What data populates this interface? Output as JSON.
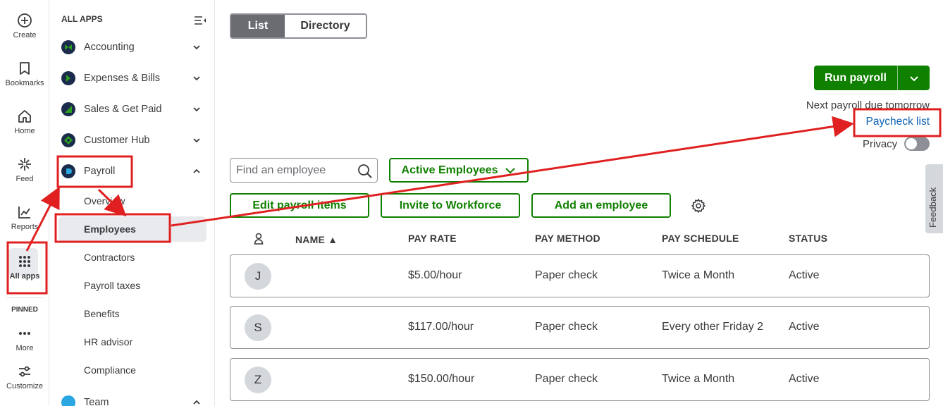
{
  "rail": {
    "create": "Create",
    "bookmarks": "Bookmarks",
    "home": "Home",
    "feed": "Feed",
    "reports": "Reports",
    "all_apps": "All apps",
    "pinned": "PINNED",
    "more": "More",
    "customize": "Customize"
  },
  "nav": {
    "header": "ALL APPS",
    "items": [
      {
        "label": "Accounting",
        "icon": "accounting-icon"
      },
      {
        "label": "Expenses & Bills",
        "icon": "expenses-icon"
      },
      {
        "label": "Sales & Get Paid",
        "icon": "sales-icon"
      },
      {
        "label": "Customer Hub",
        "icon": "customer-hub-icon"
      },
      {
        "label": "Payroll",
        "icon": "payroll-icon"
      },
      {
        "label": "Team",
        "icon": "team-icon"
      }
    ],
    "payroll_sub": [
      "Overview",
      "Employees",
      "Contractors",
      "Payroll taxes",
      "Benefits",
      "HR advisor",
      "Compliance"
    ]
  },
  "main": {
    "view_toggle": {
      "list": "List",
      "directory": "Directory"
    },
    "run_payroll": "Run payroll",
    "next_payroll": "Next payroll due tomorrow",
    "paycheck_list": "Paycheck list",
    "privacy": "Privacy",
    "search_placeholder": "Find an employee",
    "filter": "Active Employees",
    "buttons": {
      "edit_items": "Edit payroll items",
      "invite": "Invite to Workforce",
      "add_employee": "Add an employee"
    },
    "columns": {
      "name": "NAME ▲",
      "pay_rate": "PAY RATE",
      "pay_method": "PAY METHOD",
      "pay_schedule": "PAY SCHEDULE",
      "status": "STATUS"
    },
    "rows": [
      {
        "initial": "J",
        "pay_rate": "$5.00/hour",
        "pay_method": "Paper check",
        "pay_schedule": "Twice a Month",
        "status": "Active"
      },
      {
        "initial": "S",
        "pay_rate": "$117.00/hour",
        "pay_method": "Paper check",
        "pay_schedule": "Every other Friday 2",
        "status": "Active"
      },
      {
        "initial": "Z",
        "pay_rate": "$150.00/hour",
        "pay_method": "Paper check",
        "pay_schedule": "Twice a Month",
        "status": "Active"
      }
    ]
  },
  "feedback": "Feedback",
  "colors": {
    "brand_green": "#108000",
    "link_blue": "#0d62b5",
    "annotation_red": "#e02020"
  }
}
